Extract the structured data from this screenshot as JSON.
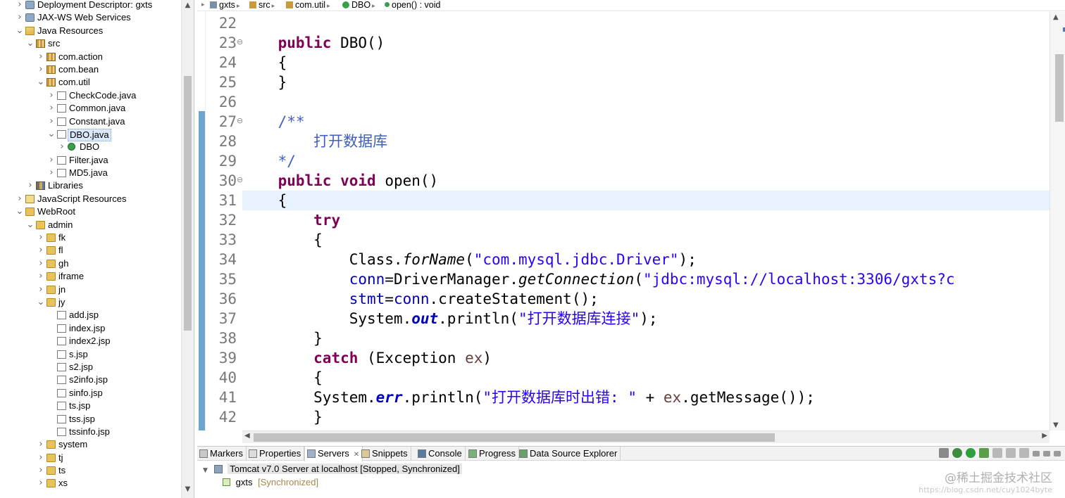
{
  "project_explorer": {
    "items": [
      {
        "label": "Deployment Descriptor: gxts",
        "depth": 0,
        "arrow": "closed",
        "icon": "deployment-descriptor-icon"
      },
      {
        "label": "JAX-WS Web Services",
        "depth": 0,
        "arrow": "closed",
        "icon": "web-services-icon"
      },
      {
        "label": "Java Resources",
        "depth": 0,
        "arrow": "open",
        "icon": "java-resources-icon"
      },
      {
        "label": "src",
        "depth": 1,
        "arrow": "open",
        "icon": "source-folder-icon"
      },
      {
        "label": "com.action",
        "depth": 2,
        "arrow": "closed",
        "icon": "package-icon"
      },
      {
        "label": "com.bean",
        "depth": 2,
        "arrow": "closed",
        "icon": "package-icon"
      },
      {
        "label": "com.util",
        "depth": 2,
        "arrow": "open",
        "icon": "package-icon"
      },
      {
        "label": "CheckCode.java",
        "depth": 3,
        "arrow": "closed",
        "icon": "java-file-icon"
      },
      {
        "label": "Common.java",
        "depth": 3,
        "arrow": "closed",
        "icon": "java-file-icon"
      },
      {
        "label": "Constant.java",
        "depth": 3,
        "arrow": "closed",
        "icon": "java-file-icon"
      },
      {
        "label": "DBO.java",
        "depth": 3,
        "arrow": "open",
        "icon": "java-file-icon",
        "selected": true
      },
      {
        "label": "DBO",
        "depth": 4,
        "arrow": "closed",
        "icon": "class-icon"
      },
      {
        "label": "Filter.java",
        "depth": 3,
        "arrow": "closed",
        "icon": "java-file-icon"
      },
      {
        "label": "MD5.java",
        "depth": 3,
        "arrow": "closed",
        "icon": "java-file-icon"
      },
      {
        "label": "Libraries",
        "depth": 1,
        "arrow": "closed",
        "icon": "library-icon"
      },
      {
        "label": "JavaScript Resources",
        "depth": 0,
        "arrow": "closed",
        "icon": "javascript-resources-icon"
      },
      {
        "label": "WebRoot",
        "depth": 0,
        "arrow": "open",
        "icon": "folder-icon"
      },
      {
        "label": "admin",
        "depth": 1,
        "arrow": "open",
        "icon": "folder-icon"
      },
      {
        "label": "fk",
        "depth": 2,
        "arrow": "closed",
        "icon": "folder-icon"
      },
      {
        "label": "fl",
        "depth": 2,
        "arrow": "closed",
        "icon": "folder-icon"
      },
      {
        "label": "gh",
        "depth": 2,
        "arrow": "closed",
        "icon": "folder-icon"
      },
      {
        "label": "iframe",
        "depth": 2,
        "arrow": "closed",
        "icon": "folder-icon"
      },
      {
        "label": "jn",
        "depth": 2,
        "arrow": "closed",
        "icon": "folder-icon"
      },
      {
        "label": "jy",
        "depth": 2,
        "arrow": "open",
        "icon": "folder-icon"
      },
      {
        "label": "add.jsp",
        "depth": 3,
        "arrow": "none",
        "icon": "jsp-file-icon"
      },
      {
        "label": "index.jsp",
        "depth": 3,
        "arrow": "none",
        "icon": "jsp-file-icon"
      },
      {
        "label": "index2.jsp",
        "depth": 3,
        "arrow": "none",
        "icon": "jsp-file-icon"
      },
      {
        "label": "s.jsp",
        "depth": 3,
        "arrow": "none",
        "icon": "jsp-file-icon"
      },
      {
        "label": "s2.jsp",
        "depth": 3,
        "arrow": "none",
        "icon": "jsp-file-icon"
      },
      {
        "label": "s2info.jsp",
        "depth": 3,
        "arrow": "none",
        "icon": "jsp-file-icon"
      },
      {
        "label": "sinfo.jsp",
        "depth": 3,
        "arrow": "none",
        "icon": "jsp-file-icon"
      },
      {
        "label": "ts.jsp",
        "depth": 3,
        "arrow": "none",
        "icon": "jsp-file-icon"
      },
      {
        "label": "tss.jsp",
        "depth": 3,
        "arrow": "none",
        "icon": "jsp-file-icon"
      },
      {
        "label": "tssinfo.jsp",
        "depth": 3,
        "arrow": "none",
        "icon": "jsp-file-icon"
      },
      {
        "label": "system",
        "depth": 2,
        "arrow": "closed",
        "icon": "folder-icon"
      },
      {
        "label": "tj",
        "depth": 2,
        "arrow": "closed",
        "icon": "folder-icon"
      },
      {
        "label": "ts",
        "depth": 2,
        "arrow": "closed",
        "icon": "folder-icon"
      },
      {
        "label": "xs",
        "depth": 2,
        "arrow": "closed",
        "icon": "folder-icon"
      }
    ]
  },
  "breadcrumb": {
    "items": [
      {
        "label": "gxts",
        "icon": "project-icon"
      },
      {
        "label": "src",
        "icon": "source-folder-icon"
      },
      {
        "label": "com.util",
        "icon": "package-icon"
      },
      {
        "label": "DBO",
        "icon": "class-icon"
      },
      {
        "label": "open() : void",
        "icon": "method-icon"
      }
    ]
  },
  "editor": {
    "current_line": 31,
    "lines": [
      {
        "num": "22",
        "fold": "",
        "tokens": []
      },
      {
        "num": "23",
        "fold": "⊖",
        "tokens": [
          {
            "t": "    "
          },
          {
            "t": "public",
            "c": "kw"
          },
          {
            "t": " DBO()"
          }
        ]
      },
      {
        "num": "24",
        "fold": "",
        "tokens": [
          {
            "t": "    {"
          }
        ]
      },
      {
        "num": "25",
        "fold": "",
        "tokens": [
          {
            "t": "    }"
          }
        ]
      },
      {
        "num": "26",
        "fold": "",
        "tokens": []
      },
      {
        "num": "27",
        "fold": "⊖",
        "tokens": [
          {
            "t": "    "
          },
          {
            "t": "/**",
            "c": "cm"
          }
        ]
      },
      {
        "num": "28",
        "fold": "",
        "tokens": [
          {
            "t": "        "
          },
          {
            "t": "打开数据库",
            "c": "cm"
          }
        ]
      },
      {
        "num": "29",
        "fold": "",
        "tokens": [
          {
            "t": "    "
          },
          {
            "t": "*/",
            "c": "cm"
          }
        ]
      },
      {
        "num": "30",
        "fold": "⊖",
        "tokens": [
          {
            "t": "    "
          },
          {
            "t": "public",
            "c": "kw"
          },
          {
            "t": " "
          },
          {
            "t": "void",
            "c": "kw"
          },
          {
            "t": " open()"
          }
        ]
      },
      {
        "num": "31",
        "fold": "",
        "tokens": [
          {
            "t": "    {"
          }
        ]
      },
      {
        "num": "32",
        "fold": "",
        "tokens": [
          {
            "t": "        "
          },
          {
            "t": "try",
            "c": "kw"
          }
        ]
      },
      {
        "num": "33",
        "fold": "",
        "tokens": [
          {
            "t": "        {"
          }
        ]
      },
      {
        "num": "34",
        "fold": "",
        "tokens": [
          {
            "t": "            Class."
          },
          {
            "t": "forName",
            "c": "it"
          },
          {
            "t": "("
          },
          {
            "t": "\"com.mysql.jdbc.Driver\"",
            "c": "st"
          },
          {
            "t": ");"
          }
        ]
      },
      {
        "num": "35",
        "fold": "",
        "tokens": [
          {
            "t": "            "
          },
          {
            "t": "conn",
            "c": "fld"
          },
          {
            "t": "=DriverManager."
          },
          {
            "t": "getConnection",
            "c": "it"
          },
          {
            "t": "("
          },
          {
            "t": "\"jdbc:mysql://localhost:3306/gxts?c",
            "c": "st"
          }
        ]
      },
      {
        "num": "36",
        "fold": "",
        "tokens": [
          {
            "t": "            "
          },
          {
            "t": "stmt",
            "c": "fld"
          },
          {
            "t": "="
          },
          {
            "t": "conn",
            "c": "fld"
          },
          {
            "t": ".createStatement();"
          }
        ]
      },
      {
        "num": "37",
        "fold": "",
        "tokens": [
          {
            "t": "            System."
          },
          {
            "t": "out",
            "c": "sfld"
          },
          {
            "t": ".println("
          },
          {
            "t": "\"打开数据库连接\"",
            "c": "st"
          },
          {
            "t": ");"
          }
        ]
      },
      {
        "num": "38",
        "fold": "",
        "tokens": [
          {
            "t": "        }"
          }
        ]
      },
      {
        "num": "39",
        "fold": "",
        "tokens": [
          {
            "t": "        "
          },
          {
            "t": "catch",
            "c": "kw"
          },
          {
            "t": " (Exception "
          },
          {
            "t": "ex",
            "c": "var"
          },
          {
            "t": ")"
          }
        ]
      },
      {
        "num": "40",
        "fold": "",
        "tokens": [
          {
            "t": "        {"
          }
        ]
      },
      {
        "num": "41",
        "fold": "",
        "tokens": [
          {
            "t": "        System."
          },
          {
            "t": "err",
            "c": "sfld"
          },
          {
            "t": ".println("
          },
          {
            "t": "\"打开数据库时出错: \"",
            "c": "st"
          },
          {
            "t": " + "
          },
          {
            "t": "ex",
            "c": "var"
          },
          {
            "t": ".getMessage());"
          }
        ]
      },
      {
        "num": "42",
        "fold": "",
        "tokens": [
          {
            "t": "        }"
          }
        ]
      }
    ]
  },
  "bottom_panel": {
    "tabs": [
      {
        "label": "Markers",
        "icon": "markers-icon",
        "active": false
      },
      {
        "label": "Properties",
        "icon": "properties-icon",
        "active": false
      },
      {
        "label": "Servers",
        "icon": "servers-icon",
        "active": true,
        "close": "✕"
      },
      {
        "label": "Snippets",
        "icon": "snippets-icon",
        "active": false
      },
      {
        "label": "Console",
        "icon": "console-icon",
        "active": false
      },
      {
        "label": "Progress",
        "icon": "progress-icon",
        "active": false
      },
      {
        "label": "Data Source Explorer",
        "icon": "data-source-explorer-icon",
        "active": false
      }
    ],
    "toolbar": [
      {
        "name": "collapse-all-icon",
        "color": "#8a8a8a"
      },
      {
        "name": "debug-server-icon",
        "color": "#3d8b3d"
      },
      {
        "name": "start-server-icon",
        "color": "#2e9e3e"
      },
      {
        "name": "profile-server-icon",
        "color": "#5a9e4a"
      },
      {
        "name": "stop-server-icon",
        "color": "#b8b8b8"
      },
      {
        "name": "publish-icon",
        "color": "#b8b8b8"
      },
      {
        "name": "disconnect-icon",
        "color": "#b8b8b8"
      },
      {
        "name": "view-menu-icon",
        "color": "#9a9a9a"
      },
      {
        "name": "minimize-icon",
        "color": "#9a9a9a"
      },
      {
        "name": "maximize-icon",
        "color": "#9a9a9a"
      }
    ],
    "server": {
      "label": "Tomcat v7.0 Server at localhost  [Stopped, Synchronized]"
    },
    "module": {
      "label": "gxts",
      "status": "[Synchronized]"
    }
  },
  "watermark": {
    "line1": "@稀土掘金技术社区",
    "line2": "https://blog.csdn.net/cuy1024byte"
  },
  "colors": {
    "keyword": "#7f0055",
    "comment": "#3f5fbf",
    "string": "#2a00ff",
    "field": "#0000c0",
    "current_line": "#e8f2fe",
    "change_bar": "#6ba6d0"
  }
}
